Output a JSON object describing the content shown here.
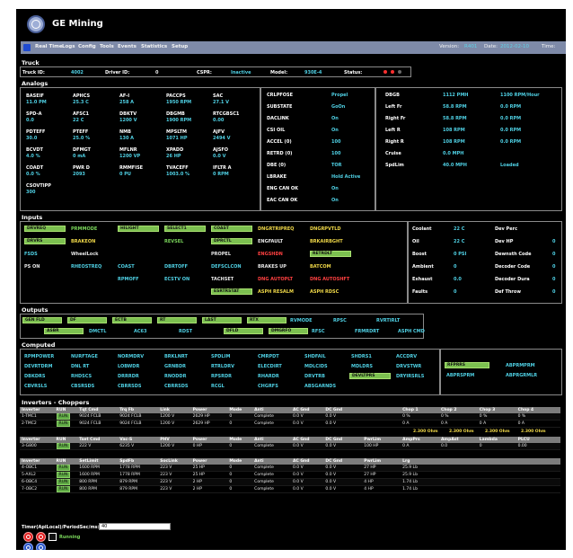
{
  "app": {
    "title": "GE Mining"
  },
  "nav": {
    "items": [
      "Real Time",
      "Logs",
      "Config",
      "Tools",
      "Events",
      "Statistics",
      "Setup"
    ],
    "version_label": "Version:",
    "version_value": "R401",
    "date_label": "Date:",
    "date_value": "2012-02-10",
    "time_label": "Time:"
  },
  "truck": {
    "title": "Truck",
    "labels": [
      "Truck ID:",
      "Driver ID:",
      "CSPR:",
      "Model:",
      "Status:"
    ],
    "values": [
      "4002",
      "0",
      "Inactive",
      "930E-4",
      "• •"
    ]
  },
  "analogs": {
    "title": "Analogs",
    "col1": [
      {
        "l": "BASEIF",
        "v": "11.0 PM"
      },
      {
        "l": "SPD-A",
        "v": "0.0"
      },
      {
        "l": "PDTEFF",
        "v": "30.0"
      },
      {
        "l": "BCVDT",
        "v": "4.0 %"
      },
      {
        "l": "COADT",
        "v": "0.0 %"
      },
      {
        "l": "CSOVTIPP",
        "v": "300"
      }
    ],
    "col2": [
      {
        "l": "APHCS",
        "v": "25.3 C"
      },
      {
        "l": "AFSC1",
        "v": "22 C"
      },
      {
        "l": "PTEFF",
        "v": "25.0 %"
      },
      {
        "l": "DFMGT",
        "v": "0 mA"
      },
      {
        "l": "PWR D",
        "v": "2093"
      }
    ],
    "col3": [
      {
        "l": "AF-I",
        "v": "258 A"
      },
      {
        "l": "DBKTV",
        "v": "1200 V"
      },
      {
        "l": "NMB",
        "v": "130 A"
      },
      {
        "l": "MFLNR",
        "v": "1200 VP"
      },
      {
        "l": "RMMFISE",
        "v": "0 PU"
      }
    ],
    "col4": [
      {
        "l": "PACCPS",
        "v": "1950 RPM"
      },
      {
        "l": "DBGMB",
        "v": "1900 RPM"
      },
      {
        "l": "MPSLTM",
        "v": "1071 HP"
      },
      {
        "l": "XPADD",
        "v": "26 HP"
      },
      {
        "l": "TVACEFF",
        "v": "1003.0 %"
      }
    ],
    "col5": [
      {
        "l": "SAC",
        "v": "27.1 V"
      },
      {
        "l": "RTCGBSC1",
        "v": "0.00"
      },
      {
        "l": "AJFV",
        "v": "2494 V"
      },
      {
        "l": "AJSFO",
        "v": "0.0 V"
      },
      {
        "l": "IFLTR A",
        "v": "0 RPM"
      }
    ],
    "mid_labels": [
      "CRLPFOSE",
      "SUBSTATE",
      "DACLINK",
      "CSI OIL",
      "ACCEL (0)",
      "RETRD (0)",
      "DBE (0)",
      "LBRAKE",
      "ENG CAN OK",
      "EAC CAN OK"
    ],
    "mid_values": [
      "Propel",
      "GoOn",
      "On",
      "On",
      "100",
      "100",
      "TOR",
      "Hold Active",
      "On",
      "On"
    ],
    "right": [
      {
        "l": "DBGB",
        "v1": "1112 PMH",
        "v2": "1100 RPM/Hour"
      },
      {
        "l": "Left Fr",
        "v1": "58.8 RPM",
        "v2": "0.0 RPM"
      },
      {
        "l": "Right Fr",
        "v1": "58.8 RPM",
        "v2": "0.0 RPM"
      },
      {
        "l": "Left R",
        "v1": "108 RPM",
        "v2": "0.0 RPM"
      },
      {
        "l": "Right R",
        "v1": "108 RPM",
        "v2": "0.0 RPM"
      },
      {
        "l": "Cruise",
        "v1": "0.0 MPH",
        "v2": ""
      },
      {
        "l": "SpdLim",
        "v1": "40.0 MPH",
        "v2": "Loaded"
      }
    ]
  },
  "inputs": {
    "title": "Inputs",
    "row1": [
      "DRVREQ",
      "PRMMODE",
      "HILIGHT",
      "SELECT1",
      "COAST",
      "DNGRTRIPREQ",
      "DNGRPVTLD"
    ],
    "row2": [
      "DRVRS",
      "BRAKEON",
      "REVSEL",
      "DPRCTL",
      "ENGFAULT",
      "BRKAIRBGHT"
    ],
    "row3": [
      "FSDS",
      "WheelLock",
      "PROPEL",
      "ENGSHDN",
      "RETRDLT"
    ],
    "row4": [
      "PS ON",
      "RHEOSTREQ",
      "COAST",
      "DBRTOFF",
      "DEFSCLCON",
      "BRAKES UP",
      "BATCOM"
    ],
    "row5": [
      "RPMOFF",
      "ECSTV ON",
      "TACHSET",
      "DNG AUTOPLT",
      "DNG AUTOSHFT"
    ],
    "row6": [
      "ESRTRSTAT",
      "ASPH RESALM",
      "ASPH RDSC"
    ],
    "right": [
      {
        "l": "Coolant",
        "v": "22 C",
        "l2": "Dev Perc",
        "v2": ""
      },
      {
        "l": "Oil",
        "v": "22 C",
        "l2": "Dev HP",
        "v2": "0"
      },
      {
        "l": "Boost",
        "v": "0 PSI",
        "l2": "Dewnsth Code",
        "v2": "0"
      },
      {
        "l": "Ambient",
        "v": "0",
        "l2": "Decoder Code",
        "v2": "0"
      },
      {
        "l": "Exhaust",
        "v": "0.0",
        "l2": "Decoder Dura",
        "v2": "0"
      },
      {
        "l": "Faults",
        "v": "0",
        "l2": "Def Throw",
        "v2": "0"
      }
    ]
  },
  "outputs": {
    "title": "Outputs",
    "row1": [
      "GEN FLD",
      "DF",
      "ECTB",
      "RT",
      "LAST",
      "RTX",
      "RVMODE",
      "RPSC",
      "RVRTIRLT"
    ],
    "row2": [
      "ASBR",
      "DMCTL",
      "AC63",
      "RDST",
      "DFLD",
      "DMGRFO",
      "RFSC",
      "FRMRDRT",
      "ASPH CMD"
    ]
  },
  "computed": {
    "title": "Computed",
    "rows": [
      [
        "RPMPOWER",
        "NURFTAGE",
        "NORMDRV",
        "BRKLNRT",
        "SPDLIM",
        "CMRPDT",
        "SHDFAIL",
        "SHDRS1",
        "ACCDRV"
      ],
      [
        "DEVRTDRM",
        "DNL RT",
        "LOBWDR",
        "GRNBDR",
        "RTRLDRV",
        "ELECDIRT",
        "MDLCIDS",
        "MDLDRS",
        "DRVSTWR"
      ],
      [
        "DBKDRS",
        "RHDSCS",
        "DRRRDR",
        "RNODDR",
        "RPSRDR",
        "RHARDR",
        "DRVTRB",
        "DEVLTPRS",
        "DRYIRSRLS"
      ],
      [
        "CBVRSLS",
        "CBSRSDS",
        "CBRRSDS",
        "CBRRSDS",
        "RCGL",
        "CHGRFS",
        "ABSGARNDS"
      ]
    ],
    "right": [
      "RFPRRS",
      "ABPRMPRM",
      "ABPRSPRM",
      "ABPRGRMLR"
    ]
  },
  "inverters": {
    "title": "Inverters - Choppers",
    "header1": [
      "Inverter",
      "RUN",
      "Tqt Cmd",
      "Trq Fb",
      "Link",
      "Power",
      "Mode",
      "Anti",
      "AC Gnd",
      "DC Gnd",
      "",
      "Chop 1",
      "Chop 2",
      "Chop 3",
      "Chop 4"
    ],
    "rows1": [
      [
        "1-TMC1",
        "RUN",
        "9024 FCLB",
        "9024 FCLB",
        "1200 V",
        "2629 HP",
        "0",
        "Complete",
        "0.0 V",
        "0.0 V",
        "",
        "0 %",
        "0 %",
        "0 %",
        "0 %"
      ],
      [
        "2-TMC2",
        "RUN",
        "9024 FCLB",
        "9024 FCLB",
        "1200 V",
        "2629 HP",
        "0",
        "Complete",
        "0.0 V",
        "0.0 V",
        "",
        "0 A",
        "0 A",
        "0 A",
        "0 A"
      ]
    ],
    "ohm_row": [
      "2.300 Ohm",
      "2.300 Ohm",
      "2.300 Ohm",
      "2.300 Ohm"
    ],
    "header2": [
      "Inverter",
      "RUN",
      "Tset Cmd",
      "Vac-S",
      "PHV",
      "Power",
      "Mode",
      "Anti",
      "AC Gnd",
      "DC Gnd",
      "PwrLim",
      "AmpPrs",
      "AmpAst",
      "Lambda",
      "PLCU"
    ],
    "rows2": [
      [
        "3-G800",
        "RUN",
        "222 V",
        "6235 V",
        "1200 V",
        "0 HP",
        "0",
        "Complete",
        "0.0 V",
        "0.0 V",
        "100 HP",
        "0 A",
        "0.0",
        "0",
        "0.00"
      ]
    ],
    "header3": [
      "Inverter",
      "RUN",
      "SetLimit",
      "SpdFb",
      "SocLink",
      "Power",
      "Mode",
      "Anti",
      "AC Gnd",
      "DC Gnd",
      "PwrLim",
      "Lrg",
      "",
      "",
      ""
    ],
    "rows3": [
      [
        "4-OBC1",
        "RUN",
        "1600 RPM",
        "1778 RPM",
        "223 V",
        "25 HP",
        "0",
        "Complete",
        "0.0 V",
        "0.0 V",
        "27 HP",
        "25.9 Lb",
        "",
        "",
        ""
      ],
      [
        "5-AXL2",
        "RUN",
        "1600 RPM",
        "1778 RPM",
        "223 V",
        "25 HP",
        "0",
        "Complete",
        "0.0 V",
        "0.0 V",
        "27 HP",
        "25.9 Lb",
        "",
        "",
        ""
      ],
      [
        "6-OBC4",
        "RUN",
        "800 RPM",
        "879 RPM",
        "223 V",
        "2 HP",
        "0",
        "Complete",
        "0.0 V",
        "0.0 V",
        "4 HP",
        "1.74 Lb",
        "",
        "",
        ""
      ],
      [
        "7-OBC2",
        "RUN",
        "800 RPM",
        "879 RPM",
        "223 V",
        "2 HP",
        "0",
        "Complete",
        "0.0 V",
        "0.0 V",
        "4 HP",
        "1.74 Lb",
        "",
        "",
        ""
      ]
    ]
  },
  "footer": {
    "timer_label": "Timer(ApiLocal)/PeriodSec/ms:",
    "timer_value": "40",
    "running_label": "Running"
  }
}
